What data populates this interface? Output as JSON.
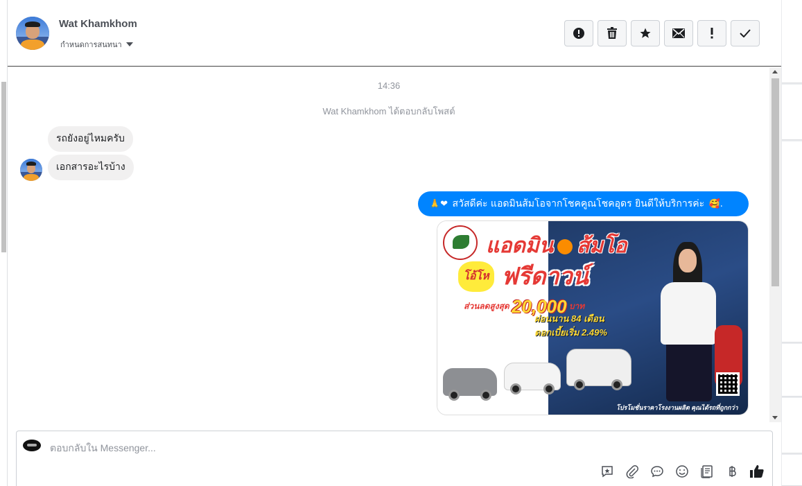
{
  "header": {
    "contact_name": "Wat Khamkhom",
    "assign_label": "กำหนดการสนทนา",
    "actions": [
      {
        "name": "mark-spam",
        "icon": "alert-circle-icon",
        "glyph": "!"
      },
      {
        "name": "delete",
        "icon": "trash-icon",
        "glyph": "🗑"
      },
      {
        "name": "star",
        "icon": "star-icon",
        "glyph": "★"
      },
      {
        "name": "mark-unread",
        "icon": "envelope-icon",
        "glyph": "✉"
      },
      {
        "name": "follow-up",
        "icon": "exclamation-icon",
        "glyph": "!"
      },
      {
        "name": "mark-done",
        "icon": "check-icon",
        "glyph": "✓"
      }
    ]
  },
  "thread": {
    "timestamp": "14:36",
    "event_text": "Wat Khamkhom ได้ตอบกลับโพสต์",
    "incoming": [
      "รถยังอยู่ไหมครับ",
      "เอกสารอะไรบ้าง"
    ],
    "outgoing": {
      "prefix_emoji": "🙏❤",
      "text": "สวัสดีค่ะ แอดมินส้มโอจากโชคคูณโชคอุดร ยินดีให้บริการค่ะ",
      "suffix_emoji": "🥰."
    },
    "ad_image": {
      "headline": "แอดมิน",
      "headline_name": "ส้มโอ",
      "burst": "โอ้โห",
      "offer": "ฟรีดาวน์",
      "discount_label": "ส่วนลดสูงสุด",
      "discount_amount": "20,000",
      "discount_unit": "บาท",
      "installment": "ผ่อนนาน 84 เดือน",
      "interest": "ดอกเบี้ยเริ่ม 2.49%",
      "footer": "โปรโมชั่นราคาโรงงานผลิต คุณได้รถที่ถูกกว่า"
    }
  },
  "composer": {
    "placeholder": "ตอบกลับใน Messenger...",
    "tools": [
      {
        "name": "saved-reply",
        "icon": "saved-reply-icon",
        "glyph": "✦"
      },
      {
        "name": "attach",
        "icon": "paperclip-icon",
        "glyph": "⌀"
      },
      {
        "name": "chat",
        "icon": "speech-bubble-icon",
        "glyph": "💬"
      },
      {
        "name": "emoji",
        "icon": "smiley-icon",
        "glyph": "☺"
      },
      {
        "name": "notes",
        "icon": "notes-icon",
        "glyph": "▤"
      },
      {
        "name": "payment",
        "icon": "baht-icon",
        "glyph": "฿"
      },
      {
        "name": "like",
        "icon": "thumbs-up-icon",
        "glyph": "👍"
      }
    ]
  }
}
